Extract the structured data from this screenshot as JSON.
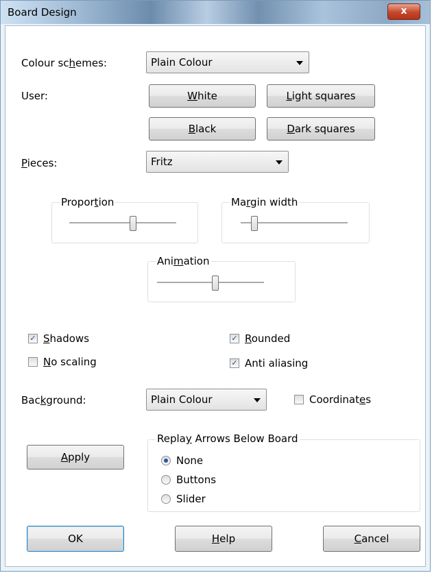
{
  "window": {
    "title": "Board Design",
    "close_glyph": "x"
  },
  "colour_schemes": {
    "label_pre": "Colour sc",
    "label_key": "h",
    "label_post": "emes:",
    "value": "Plain Colour"
  },
  "user": {
    "label": "User:",
    "white": {
      "key": "W",
      "rest": "hite"
    },
    "light": {
      "key": "L",
      "rest": "ight squares"
    },
    "black": {
      "key": "B",
      "rest": "lack"
    },
    "dark": {
      "key": "D",
      "rest": "ark squares"
    }
  },
  "pieces": {
    "label_key": "P",
    "label_rest": "ieces:",
    "value": "Fritz"
  },
  "proportion": {
    "pre": "Propor",
    "key": "t",
    "post": "ion",
    "level": 0.6
  },
  "margin": {
    "pre": "Ma",
    "key": "r",
    "post": "gin width",
    "level": 0.1
  },
  "animation": {
    "pre": "Ani",
    "key": "m",
    "post": "ation",
    "level": 0.55
  },
  "options": {
    "shadows": {
      "key": "S",
      "rest": "hadows",
      "checked": true
    },
    "no_scaling": {
      "key": "N",
      "rest": "o scaling",
      "checked": false
    },
    "rounded": {
      "key": "R",
      "rest": "ounded",
      "checked": true
    },
    "anti_aliasing": {
      "label": "Anti aliasing",
      "checked": true
    }
  },
  "background": {
    "pre": "Bac",
    "key": "k",
    "post": "ground:",
    "value": "Plain Colour"
  },
  "coordinates": {
    "pre": "Coordinat",
    "key": "e",
    "post": "s",
    "checked": false
  },
  "apply": {
    "key": "A",
    "rest": "pply"
  },
  "replay": {
    "title_pre": "Repla",
    "title_key": "y",
    "title_post": " Arrows Below Board",
    "options": [
      "None",
      "Buttons",
      "Slider"
    ],
    "selected": "None"
  },
  "footer": {
    "ok": "OK",
    "help": {
      "key": "H",
      "rest": "elp"
    },
    "cancel": {
      "key": "C",
      "rest": "ancel"
    }
  },
  "colors": {
    "check": "#1c4d91",
    "radio_dot": "#1f59a8",
    "frame_border": "#7e9ab5"
  }
}
